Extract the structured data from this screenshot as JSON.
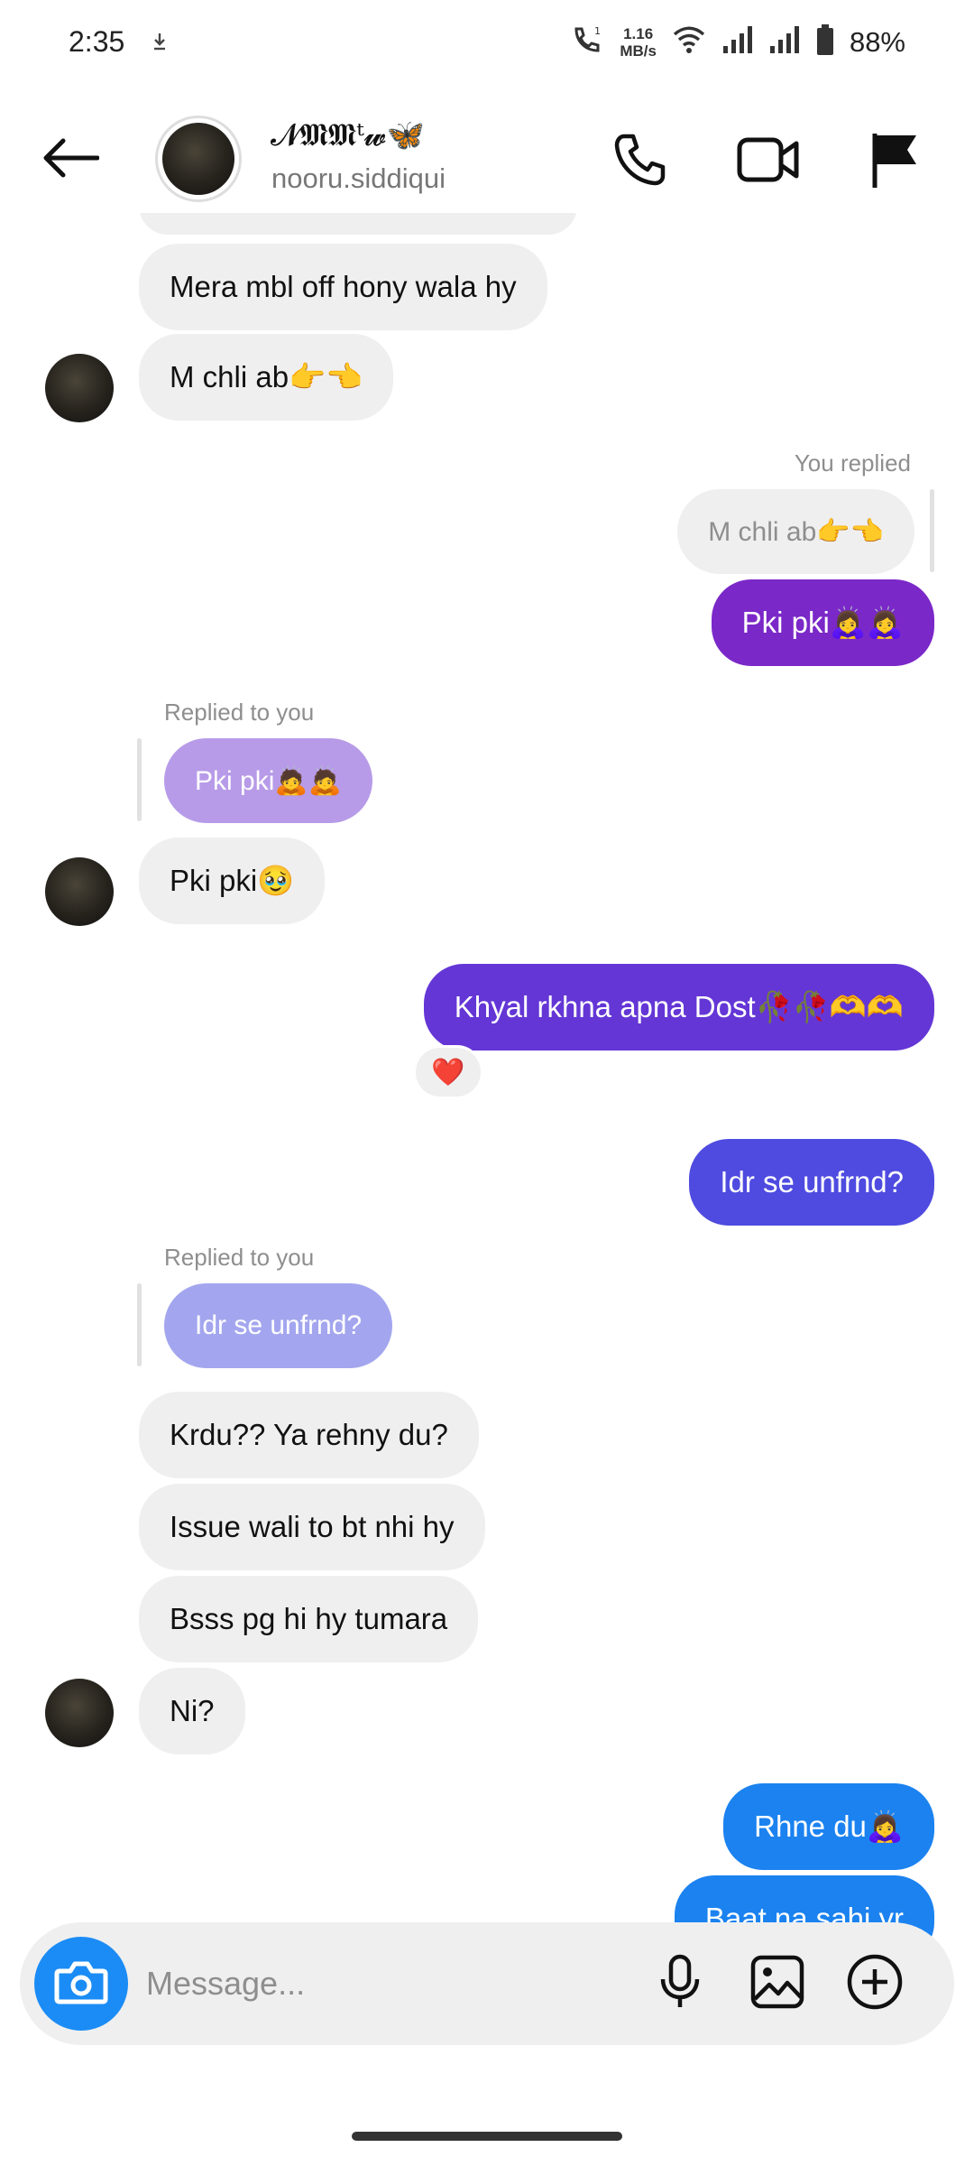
{
  "status": {
    "time": "2:35",
    "net_speed_value": "1.16",
    "net_speed_unit": "MB/s",
    "battery": "88%",
    "icons": [
      "download-icon",
      "wifi-call-icon",
      "wifi-icon",
      "signal-icon",
      "battery-icon"
    ]
  },
  "header": {
    "display_name": "𝓝𝕸𝕸ᵗ𝔀🦋",
    "username": "nooru.siddiqui",
    "icons": [
      "back-arrow-icon",
      "phone-icon",
      "video-camera-icon",
      "flag-icon"
    ]
  },
  "messages": {
    "m1": "Mera mbl off hony wala hy",
    "m2": "M chli ab👉👈",
    "you_replied_label": "You replied",
    "you_replied_quote": "M chli ab👉👈",
    "m3": "Pki pki🙇‍♀️🙇‍♀️",
    "replied_to_you_1": "Replied to you",
    "reply_quote_1": "Pki pki🙇🙇",
    "m4": "Pki pki🥹",
    "m5": "Khyal rkhna apna Dost🥀🥀🫶🫶",
    "reaction": "❤️",
    "m6": "Idr se unfrnd?",
    "replied_to_you_2": "Replied to you",
    "reply_quote_2": "Idr se unfrnd?",
    "m7": "Krdu?? Ya rehny du?",
    "m8": "Issue wali to bt nhi hy",
    "m9": "Bsss pg hi hy tumara",
    "m10": "Ni?",
    "m11": "Rhne du🙇‍♀️",
    "m12": "Baat na sahi yr"
  },
  "composer": {
    "placeholder": "Message...",
    "icons": [
      "camera-icon",
      "microphone-icon",
      "image-icon",
      "add-icon"
    ]
  },
  "colors": {
    "purple_bubble": "#7b28c8",
    "violet_bubble": "#6436d6",
    "indigo_bubble": "#4f4be0",
    "blue_bubble": "#1b82f0",
    "incoming_bubble": "#efefef",
    "camera_blue": "#1b8cf5"
  }
}
